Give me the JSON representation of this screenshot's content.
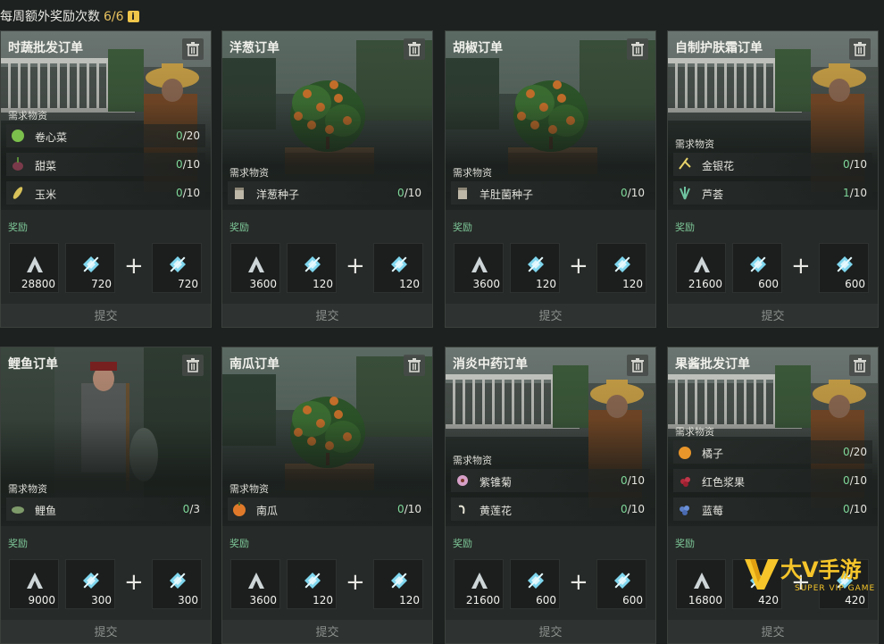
{
  "header": {
    "weekly_label": "每周额外奖励次数",
    "weekly_count": "6/6",
    "info_glyph": "i"
  },
  "labels": {
    "required": "需求物资",
    "reward": "奖励",
    "submit": "提交"
  },
  "colors": {
    "accent_yellow": "#e7c15f",
    "reward_green": "#7ec899",
    "progress_green": "#7fd89a"
  },
  "cards": [
    {
      "title": "时蔬批发订单",
      "scene": "farmer",
      "items": [
        {
          "icon": "cabbage-icon",
          "name": "卷心菜",
          "have": "0",
          "need": "/20"
        },
        {
          "icon": "beet-icon",
          "name": "甜菜",
          "have": "0",
          "need": "/10"
        },
        {
          "icon": "corn-icon",
          "name": "玉米",
          "have": "0",
          "need": "/10"
        }
      ],
      "rewards": [
        "28800",
        "720",
        "720"
      ]
    },
    {
      "title": "洋葱订单",
      "scene": "tree",
      "items": [
        {
          "icon": "seed-bag-icon",
          "name": "洋葱种子",
          "have": "0",
          "need": "/10"
        }
      ],
      "rewards": [
        "3600",
        "120",
        "120"
      ]
    },
    {
      "title": "胡椒订单",
      "scene": "tree",
      "items": [
        {
          "icon": "seed-bag-icon",
          "name": "羊肚菌种子",
          "have": "0",
          "need": "/10"
        }
      ],
      "rewards": [
        "3600",
        "120",
        "120"
      ]
    },
    {
      "title": "自制护肤霜订单",
      "scene": "farmer",
      "items": [
        {
          "icon": "honeysuckle-icon",
          "name": "金银花",
          "have": "0",
          "need": "/10"
        },
        {
          "icon": "aloe-icon",
          "name": "芦荟",
          "have": "1",
          "need": "/10"
        }
      ],
      "rewards": [
        "21600",
        "600",
        "600"
      ]
    },
    {
      "title": "鲤鱼订单",
      "scene": "hunter",
      "items": [
        {
          "icon": "carp-icon",
          "name": "鲤鱼",
          "have": "0",
          "need": "/3"
        }
      ],
      "rewards": [
        "9000",
        "300",
        "300"
      ]
    },
    {
      "title": "南瓜订单",
      "scene": "tree",
      "items": [
        {
          "icon": "pumpkin-icon",
          "name": "南瓜",
          "have": "0",
          "need": "/10"
        }
      ],
      "rewards": [
        "3600",
        "120",
        "120"
      ]
    },
    {
      "title": "消炎中药订单",
      "scene": "farmer",
      "items": [
        {
          "icon": "echinacea-icon",
          "name": "紫锥菊",
          "have": "0",
          "need": "/10"
        },
        {
          "icon": "lotus-icon",
          "name": "黄莲花",
          "have": "0",
          "need": "/10"
        }
      ],
      "rewards": [
        "21600",
        "600",
        "600"
      ]
    },
    {
      "title": "果酱批发订单",
      "scene": "farmer",
      "items": [
        {
          "icon": "orange-icon",
          "name": "橘子",
          "have": "0",
          "need": "/20"
        },
        {
          "icon": "red-berry-icon",
          "name": "红色浆果",
          "have": "0",
          "need": "/10"
        },
        {
          "icon": "blueberry-icon",
          "name": "蓝莓",
          "have": "0",
          "need": "/10"
        }
      ],
      "rewards": [
        "16800",
        "420",
        "420"
      ]
    }
  ],
  "watermark": {
    "text": "大V手游",
    "sub": "SUPER VIP GAME"
  }
}
